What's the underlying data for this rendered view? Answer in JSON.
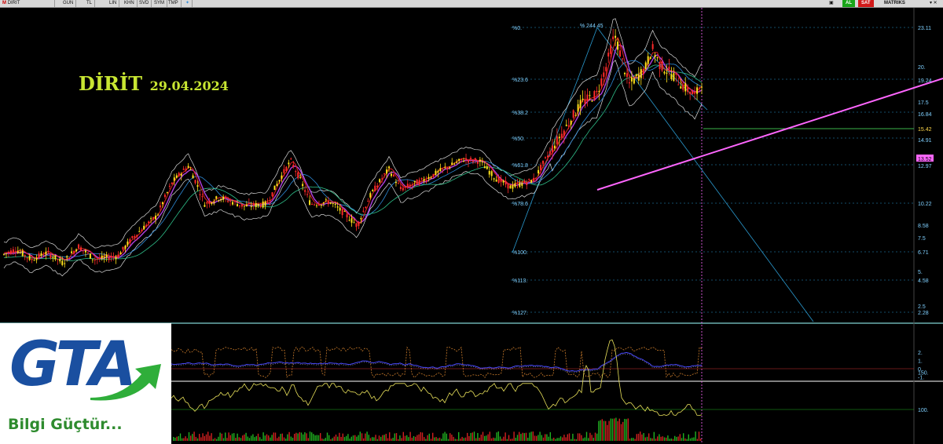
{
  "toolbar": {
    "symbol": "DIRIT",
    "periods": [
      "GUN",
      "TL",
      "LIN",
      "KHN",
      "SVD",
      "SYM",
      "TMP"
    ],
    "buttons": [
      {
        "label": "AL",
        "color": "#1aa51a"
      },
      {
        "label": "SAT",
        "color": "#d11a1a"
      }
    ],
    "brand": "MATRIKS"
  },
  "header": {
    "symbol": "DİRİT",
    "date": "29.04.2024"
  },
  "logo": {
    "mark": "GTA",
    "tagline": "Bilgi Güçtür..."
  },
  "chart_data": [
    {
      "type": "candlestick",
      "panel": "price",
      "scale": "log",
      "y_ticks": [
        {
          "value": "23.11",
          "label": "23.11",
          "highlight": false
        },
        {
          "value": "20.",
          "label": "20.",
          "highlight": false
        },
        {
          "value": "19.24",
          "label": "19.24",
          "highlight": false
        },
        {
          "value": "17.5",
          "label": "17.5",
          "highlight": false
        },
        {
          "value": "16.84",
          "label": "16.84",
          "highlight": false
        },
        {
          "value": "15.42",
          "label": "15.42",
          "highlight": true,
          "color": "#ffd84a"
        },
        {
          "value": "14.91",
          "label": "14.91",
          "highlight": false
        },
        {
          "value": "13.52",
          "label": "13.52",
          "highlight": true,
          "color": "#ff66ff"
        },
        {
          "value": "12.97",
          "label": "12.97",
          "highlight": false
        },
        {
          "value": "10.22",
          "label": "10.22",
          "highlight": false
        },
        {
          "value": "8.58",
          "label": "8.58",
          "highlight": false
        },
        {
          "value": "7.5",
          "label": "7.5",
          "highlight": false
        },
        {
          "value": "6.71",
          "label": "6.71",
          "highlight": false
        },
        {
          "value": "5.",
          "label": "5.",
          "highlight": false
        },
        {
          "value": "4.58",
          "label": "4.58",
          "highlight": false
        },
        {
          "value": "2.5",
          "label": "2.5",
          "highlight": false
        },
        {
          "value": "2.28",
          "label": "2.28",
          "highlight": false
        }
      ],
      "fibonacci_levels": [
        "%0.",
        "%23.6",
        "%38.2",
        "%50.",
        "%61.8",
        "%78.6",
        "%100.",
        "%113.",
        "%127."
      ],
      "annotations": [
        "% 244.45"
      ],
      "last_price_color": "#ffd84a",
      "support_line_color": "#ff66ff",
      "resistance_line_color": "#3bb54a"
    },
    {
      "type": "line",
      "panel": "oscillator",
      "y_ticks": [
        "2.",
        "1.",
        "0.",
        "-1."
      ],
      "series_colors": [
        "#c87a2a",
        "#4a4aff",
        "#d23232"
      ]
    },
    {
      "type": "bar",
      "panel": "volume",
      "y_ticks": [
        "150.",
        "100."
      ],
      "series_colors": [
        "#e8e05a",
        "#d02020",
        "#20b020"
      ]
    }
  ]
}
